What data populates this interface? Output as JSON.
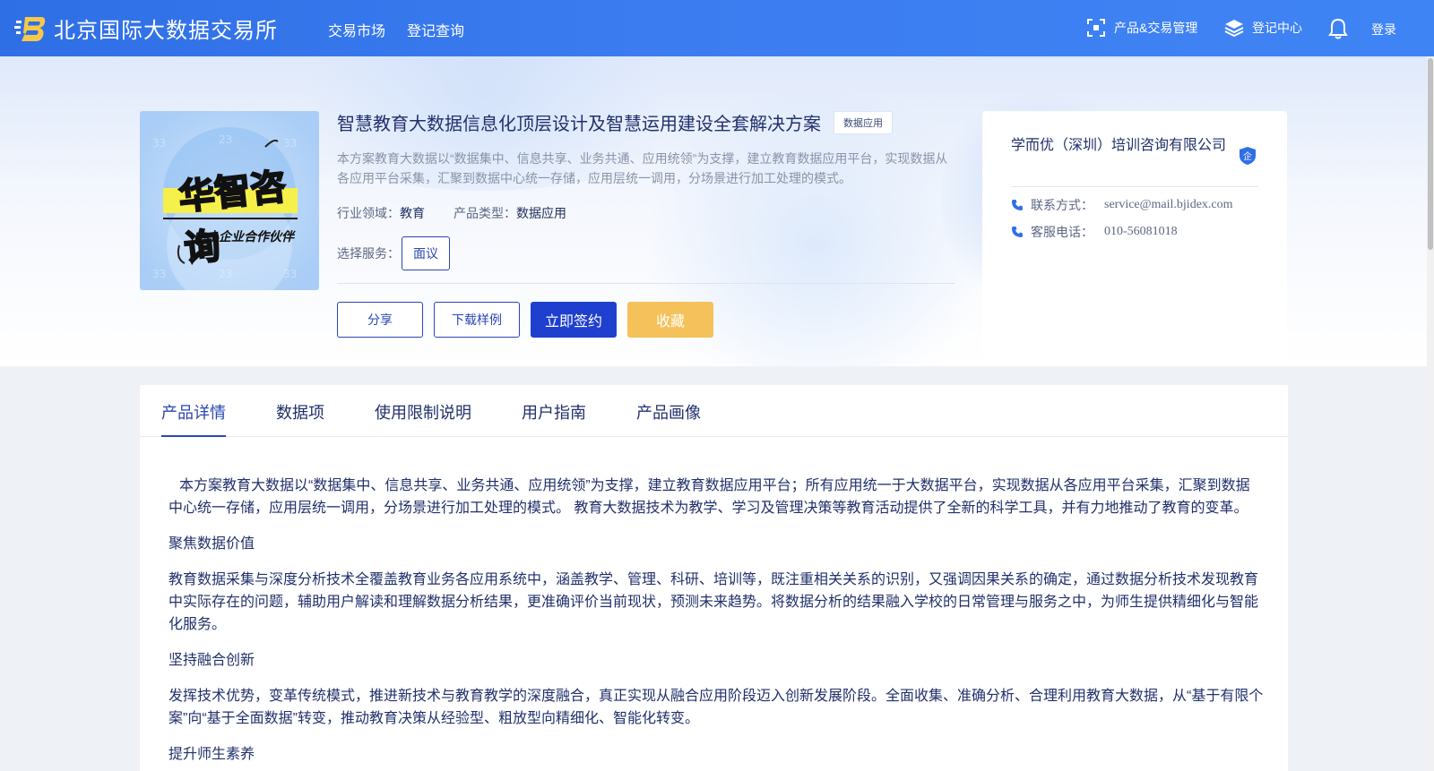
{
  "header": {
    "brand_name": "北京国际大数据交易所",
    "nav": [
      "交易市场",
      "登记查询"
    ],
    "product_trade_mgmt": "产品&交易管理",
    "registry_center": "登记中心",
    "login": "登录"
  },
  "product": {
    "title": "智慧教育大数据信息化顶层设计及智慧运用建设全套解决方案",
    "tag": "数据应用",
    "description": "本方案教育大数据以“数据集中、信息共享、业务共通、应用统领”为支撑，建立教育数据应用平台，实现数据从各应用平台采集，汇聚到数据中心统一存储，应用层统一调用，分场景进行加工处理的模式。",
    "industry_label": "行业领域：",
    "industry_value": "教育",
    "type_label": "产品类型：",
    "type_value": "数据应用",
    "service_label": "选择服务：",
    "service_option": "面议",
    "image": {
      "main_text": "华智咨询",
      "sub_text": "中小企业合作伙伴"
    }
  },
  "actions": {
    "share": "分享",
    "download_sample": "下载样例",
    "sign_now": "立即签约",
    "favorite": "收藏"
  },
  "company": {
    "name": "学而优（深圳）培训咨询有限公司",
    "badge": "企",
    "contact_label": "联系方式：",
    "contact_value": "service@mail.bjidex.com",
    "phone_label": "客服电话：",
    "phone_value": "010-56081018"
  },
  "tabs": [
    "产品详情",
    "数据项",
    "使用限制说明",
    "用户指南",
    "产品画像"
  ],
  "article": {
    "intro": "本方案教育大数据以“数据集中、信息共享、业务共通、应用统领”为支撑，建立教育数据应用平台；所有应用统一于大数据平台，实现数据从各应用平台采集，汇聚到数据中心统一存储，应用层统一调用，分场景进行加工处理的模式。 教育大数据技术为教学、学习及管理决策等教育活动提供了全新的科学工具，并有力地推动了教育的变革。",
    "h1": "聚焦数据价值",
    "p1": "教育数据采集与深度分析技术全覆盖教育业务各应用系统中，涵盖教学、管理、科研、培训等，既注重相关关系的识别，又强调因果关系的确定，通过数据分析技术发现教育中实际存在的问题，辅助用户解读和理解数据分析结果，更准确评价当前现状，预测未来趋势。将数据分析的结果融入学校的日常管理与服务之中，为师生提供精细化与智能化服务。",
    "h2": "坚持融合创新",
    "p2": "发挥技术优势，变革传统模式，推进新技术与教育教学的深度融合，真正实现从融合应用阶段迈入创新发展阶段。全面收集、准确分析、合理利用教育大数据，从“基于有限个案”向“基于全面数据”转变，推动教育决策从经验型、粗放型向精细化、智能化转变。",
    "h3": "提升师生素养"
  },
  "colors": {
    "topbar": "#3b7cf0",
    "primary": "#1f3fce",
    "accent_outline": "#2a46b3",
    "gold": "#f4c15a"
  }
}
